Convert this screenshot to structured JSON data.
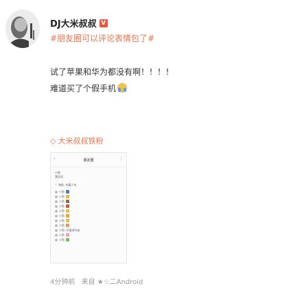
{
  "user": {
    "name": "DJ大米叔叔"
  },
  "topic": "#朋友圈可以评论表情包了#",
  "post": {
    "line1": "试了苹果和华为都没有啊！！！！",
    "line2": "难道买了个假手机"
  },
  "supertopic": "大米叔叔铁粉",
  "screenshot": {
    "title": "朋友圈",
    "user_line1": "小鱼",
    "user_line2": "我试试",
    "comment_label": "♡ 海狗, 李嘉少年,",
    "comments": [
      "小鱼",
      "小鱼",
      "小鱼",
      "小鱼",
      "小鱼",
      "小鱼",
      "小鱼",
      "小鱼",
      "小鱼: 好嘉老吗弟",
      "小鱼",
      "小鱼"
    ]
  },
  "footer": {
    "time": "4分钟前",
    "source": "来自 ★☆二Android"
  },
  "colors": {
    "accent": "#eb7350",
    "text": "#333333",
    "muted": "#999999"
  }
}
